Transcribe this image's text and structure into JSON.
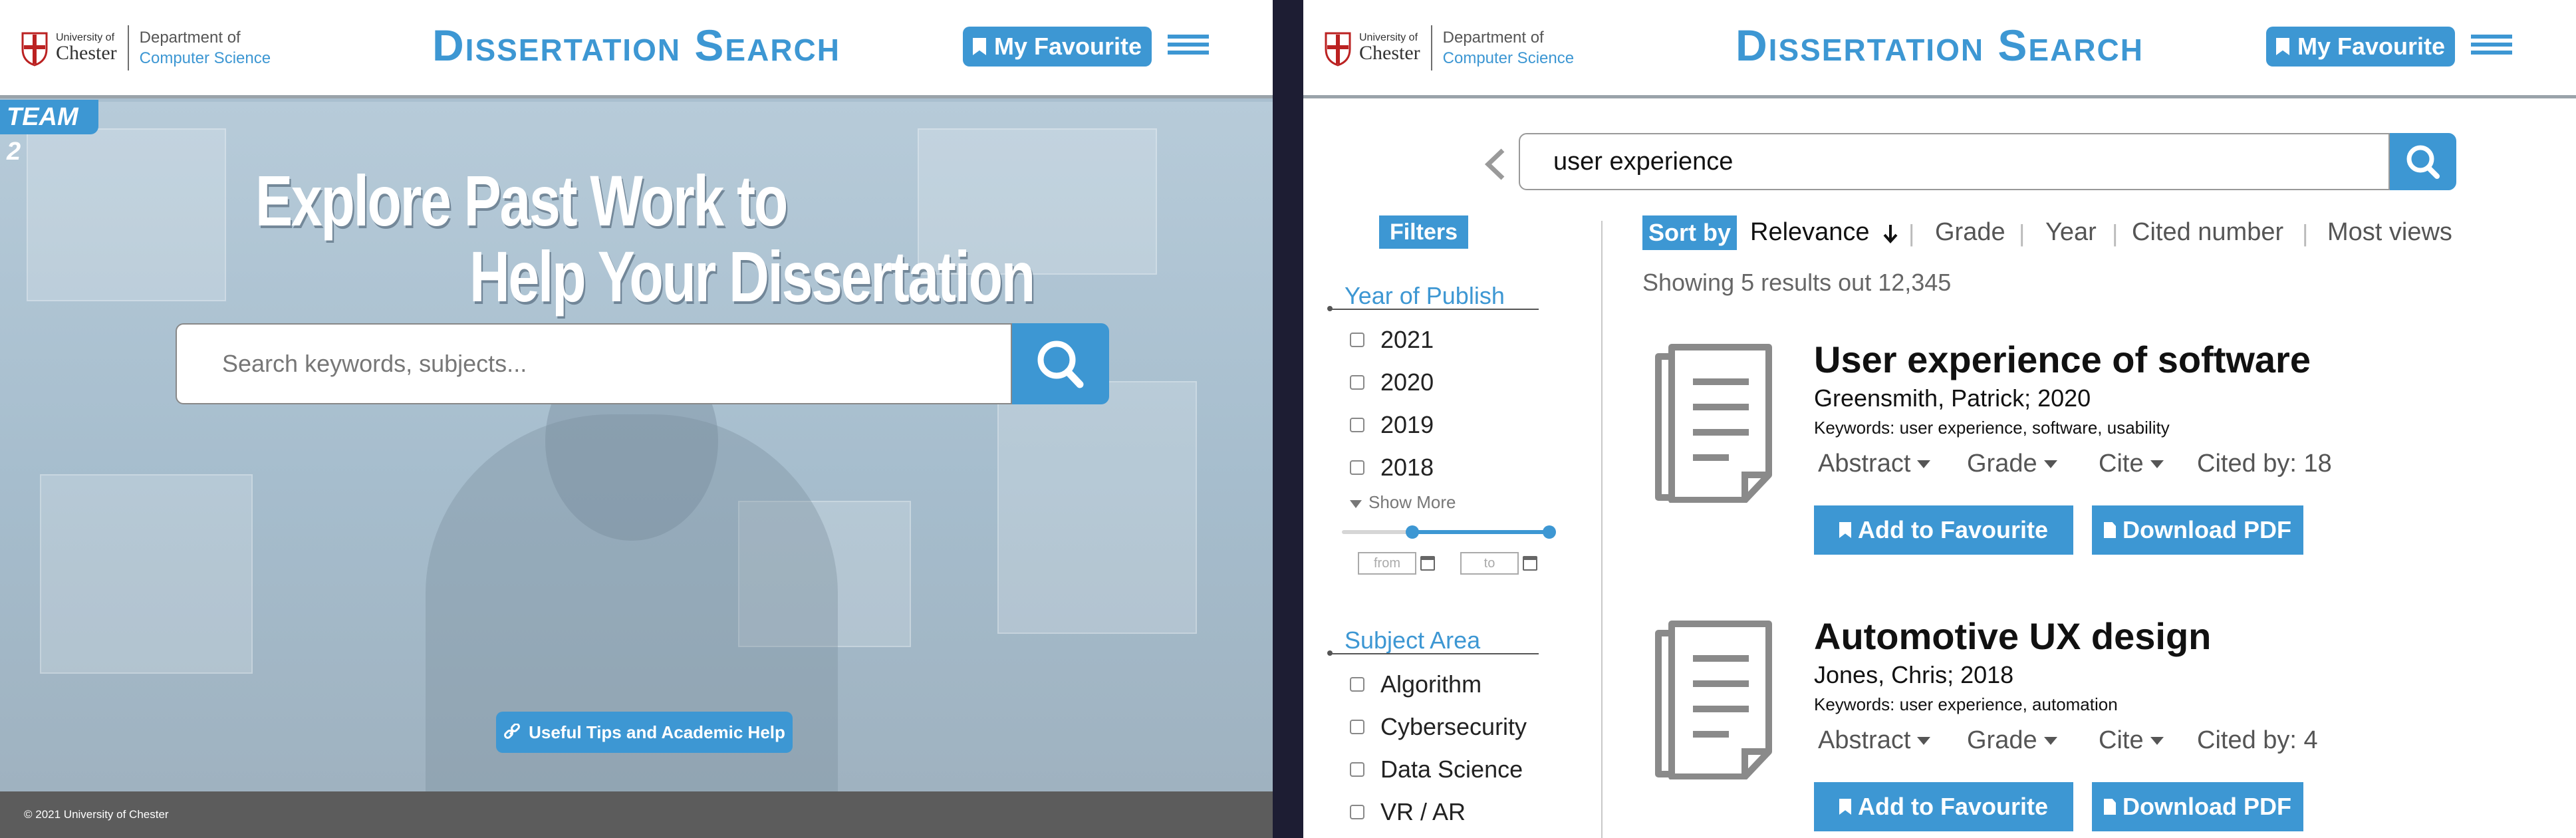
{
  "header": {
    "uni_small": "University of",
    "uni_big": "Chester",
    "dept_line1": "Department of",
    "dept_line2": "Computer Science",
    "site_title": "Dissertation Search",
    "fav_label": "My Favourite"
  },
  "landing": {
    "team_badge": "TEAM 2",
    "hero_line1": "Explore Past Work to",
    "hero_line2": "Help Your Dissertation",
    "search_placeholder": "Search keywords, subjects...",
    "tips_label": "Useful Tips and Academic Help",
    "footer": "© 2021 University of Chester"
  },
  "results": {
    "search_value": "user experience",
    "filters_label": "Filters",
    "year_title": "Year of Publish",
    "years": [
      "2021",
      "2020",
      "2019",
      "2018"
    ],
    "show_more": "Show More",
    "range_from": "from",
    "range_to": "to",
    "subject_title": "Subject Area",
    "subjects": [
      "Algorithm",
      "Cybersecurity",
      "Data Science",
      "VR / AR"
    ],
    "sort_label": "Sort by",
    "sort_options": [
      "Relevance",
      "Grade",
      "Year",
      "Cited number",
      "Most views"
    ],
    "showing": "Showing 5 results out 12,345",
    "items": [
      {
        "title": "User experience of software",
        "author": "Greensmith, Patrick; 2020",
        "keywords": "Keywords: user experience, software, usability",
        "abstract": "Abstract",
        "grade": "Grade",
        "cite": "Cite",
        "cited_by": "Cited by: 18",
        "fav_btn": "Add to Favourite",
        "pdf_btn": "Download PDF"
      },
      {
        "title": "Automotive UX design",
        "author": "Jones, Chris; 2018",
        "keywords": "Keywords: user experience,  automation",
        "abstract": "Abstract",
        "grade": "Grade",
        "cite": "Cite",
        "cited_by": "Cited by: 4",
        "fav_btn": "Add to Favourite",
        "pdf_btn": "Download PDF"
      }
    ]
  },
  "colors": {
    "accent": "#3d97d3",
    "footer": "#5c5c5c",
    "gap": "#1d1d33"
  },
  "icons": [
    "university-crest-icon",
    "bookmark-icon",
    "hamburger-menu-icon",
    "search-icon",
    "link-icon",
    "chevron-left-icon",
    "checkbox-icon",
    "caret-down-icon",
    "calendar-icon",
    "arrow-down-icon",
    "document-icon",
    "pdf-icon"
  ]
}
